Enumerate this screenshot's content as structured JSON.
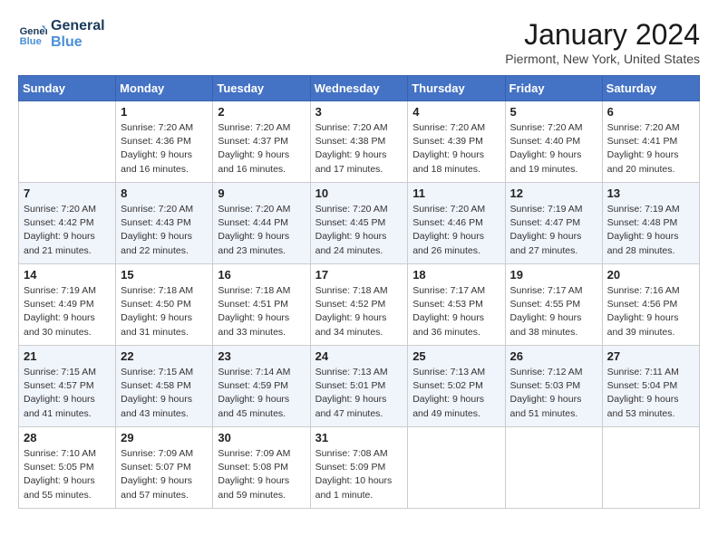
{
  "header": {
    "logo_line1": "General",
    "logo_line2": "Blue",
    "title": "January 2024",
    "subtitle": "Piermont, New York, United States"
  },
  "weekdays": [
    "Sunday",
    "Monday",
    "Tuesday",
    "Wednesday",
    "Thursday",
    "Friday",
    "Saturday"
  ],
  "weeks": [
    [
      {
        "day": "",
        "info": ""
      },
      {
        "day": "1",
        "info": "Sunrise: 7:20 AM\nSunset: 4:36 PM\nDaylight: 9 hours\nand 16 minutes."
      },
      {
        "day": "2",
        "info": "Sunrise: 7:20 AM\nSunset: 4:37 PM\nDaylight: 9 hours\nand 16 minutes."
      },
      {
        "day": "3",
        "info": "Sunrise: 7:20 AM\nSunset: 4:38 PM\nDaylight: 9 hours\nand 17 minutes."
      },
      {
        "day": "4",
        "info": "Sunrise: 7:20 AM\nSunset: 4:39 PM\nDaylight: 9 hours\nand 18 minutes."
      },
      {
        "day": "5",
        "info": "Sunrise: 7:20 AM\nSunset: 4:40 PM\nDaylight: 9 hours\nand 19 minutes."
      },
      {
        "day": "6",
        "info": "Sunrise: 7:20 AM\nSunset: 4:41 PM\nDaylight: 9 hours\nand 20 minutes."
      }
    ],
    [
      {
        "day": "7",
        "info": "Sunrise: 7:20 AM\nSunset: 4:42 PM\nDaylight: 9 hours\nand 21 minutes."
      },
      {
        "day": "8",
        "info": "Sunrise: 7:20 AM\nSunset: 4:43 PM\nDaylight: 9 hours\nand 22 minutes."
      },
      {
        "day": "9",
        "info": "Sunrise: 7:20 AM\nSunset: 4:44 PM\nDaylight: 9 hours\nand 23 minutes."
      },
      {
        "day": "10",
        "info": "Sunrise: 7:20 AM\nSunset: 4:45 PM\nDaylight: 9 hours\nand 24 minutes."
      },
      {
        "day": "11",
        "info": "Sunrise: 7:20 AM\nSunset: 4:46 PM\nDaylight: 9 hours\nand 26 minutes."
      },
      {
        "day": "12",
        "info": "Sunrise: 7:19 AM\nSunset: 4:47 PM\nDaylight: 9 hours\nand 27 minutes."
      },
      {
        "day": "13",
        "info": "Sunrise: 7:19 AM\nSunset: 4:48 PM\nDaylight: 9 hours\nand 28 minutes."
      }
    ],
    [
      {
        "day": "14",
        "info": "Sunrise: 7:19 AM\nSunset: 4:49 PM\nDaylight: 9 hours\nand 30 minutes."
      },
      {
        "day": "15",
        "info": "Sunrise: 7:18 AM\nSunset: 4:50 PM\nDaylight: 9 hours\nand 31 minutes."
      },
      {
        "day": "16",
        "info": "Sunrise: 7:18 AM\nSunset: 4:51 PM\nDaylight: 9 hours\nand 33 minutes."
      },
      {
        "day": "17",
        "info": "Sunrise: 7:18 AM\nSunset: 4:52 PM\nDaylight: 9 hours\nand 34 minutes."
      },
      {
        "day": "18",
        "info": "Sunrise: 7:17 AM\nSunset: 4:53 PM\nDaylight: 9 hours\nand 36 minutes."
      },
      {
        "day": "19",
        "info": "Sunrise: 7:17 AM\nSunset: 4:55 PM\nDaylight: 9 hours\nand 38 minutes."
      },
      {
        "day": "20",
        "info": "Sunrise: 7:16 AM\nSunset: 4:56 PM\nDaylight: 9 hours\nand 39 minutes."
      }
    ],
    [
      {
        "day": "21",
        "info": "Sunrise: 7:15 AM\nSunset: 4:57 PM\nDaylight: 9 hours\nand 41 minutes."
      },
      {
        "day": "22",
        "info": "Sunrise: 7:15 AM\nSunset: 4:58 PM\nDaylight: 9 hours\nand 43 minutes."
      },
      {
        "day": "23",
        "info": "Sunrise: 7:14 AM\nSunset: 4:59 PM\nDaylight: 9 hours\nand 45 minutes."
      },
      {
        "day": "24",
        "info": "Sunrise: 7:13 AM\nSunset: 5:01 PM\nDaylight: 9 hours\nand 47 minutes."
      },
      {
        "day": "25",
        "info": "Sunrise: 7:13 AM\nSunset: 5:02 PM\nDaylight: 9 hours\nand 49 minutes."
      },
      {
        "day": "26",
        "info": "Sunrise: 7:12 AM\nSunset: 5:03 PM\nDaylight: 9 hours\nand 51 minutes."
      },
      {
        "day": "27",
        "info": "Sunrise: 7:11 AM\nSunset: 5:04 PM\nDaylight: 9 hours\nand 53 minutes."
      }
    ],
    [
      {
        "day": "28",
        "info": "Sunrise: 7:10 AM\nSunset: 5:05 PM\nDaylight: 9 hours\nand 55 minutes."
      },
      {
        "day": "29",
        "info": "Sunrise: 7:09 AM\nSunset: 5:07 PM\nDaylight: 9 hours\nand 57 minutes."
      },
      {
        "day": "30",
        "info": "Sunrise: 7:09 AM\nSunset: 5:08 PM\nDaylight: 9 hours\nand 59 minutes."
      },
      {
        "day": "31",
        "info": "Sunrise: 7:08 AM\nSunset: 5:09 PM\nDaylight: 10 hours\nand 1 minute."
      },
      {
        "day": "",
        "info": ""
      },
      {
        "day": "",
        "info": ""
      },
      {
        "day": "",
        "info": ""
      }
    ]
  ]
}
